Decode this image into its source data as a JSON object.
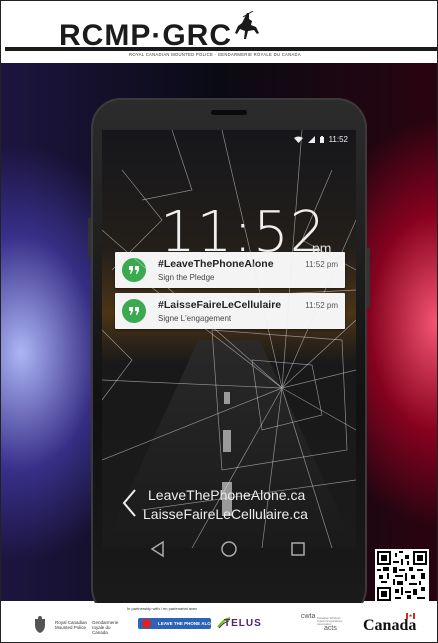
{
  "header": {
    "wordmark": "RCMP·GRC",
    "subtitle": "ROYAL CANADIAN MOUNTED POLICE · GENDARMERIE ROYALE DU CANADA"
  },
  "phone": {
    "status_time": "11:52",
    "clock_time": "11:52",
    "clock_suffix": "pm",
    "notifications": [
      {
        "title": "#LeaveThePhoneAlone",
        "subtitle": "Sign the Pledge",
        "time": "11:52 pm"
      },
      {
        "title": "#LaisseFaireLeCellulaire",
        "subtitle": "Signe L'engagement",
        "time": "11:52 pm"
      }
    ],
    "url_en": "LeaveThePhoneAlone.ca",
    "url_fr": "LaisseFaireLeCellulaire.ca"
  },
  "footer": {
    "fed_en": "Royal Canadian Mounted Police",
    "fed_fr": "Gendarmerie royale du Canada",
    "partner_caption": "In partnership with / en partenariat avec",
    "ltpa_label": "LEAVE THE PHONE ALONE",
    "telus": "TELUS",
    "cwta": "cwta",
    "acts": "acts",
    "cwta_desc": "Canadian Wireless Telecommunications Association",
    "canada": "Canada"
  },
  "colors": {
    "notification_icon": "#3aa94f",
    "telus_purple": "#4b286d",
    "ltpa_blue": "#2d63b6",
    "flag_red": "#d52b1e"
  },
  "icons": [
    "rcmp-rider-icon",
    "wifi-icon",
    "signal-icon",
    "battery-icon",
    "hangouts-icon",
    "chevron-left-icon",
    "nav-back-icon",
    "nav-home-icon",
    "nav-recents-icon",
    "qr-code",
    "canada-crest-icon",
    "flag-icon"
  ]
}
